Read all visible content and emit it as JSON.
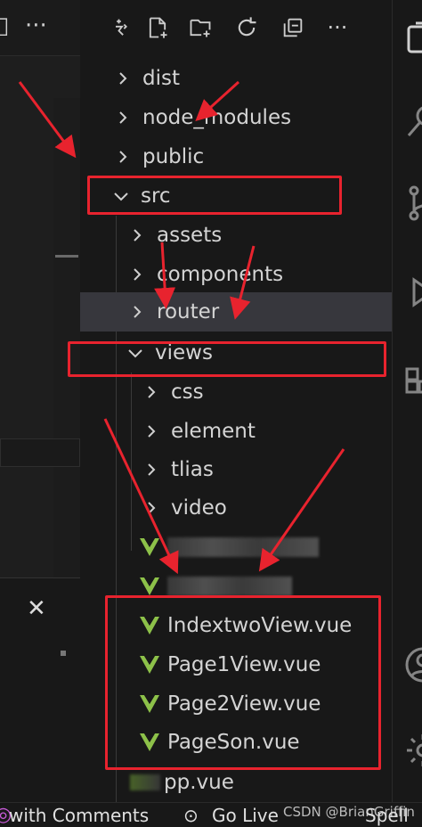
{
  "left_panel": {
    "more_label": "···",
    "close_label": "✕"
  },
  "toolbar": {
    "items": [
      {
        "icon": "extension-icon"
      },
      {
        "icon": "new-file-icon"
      },
      {
        "icon": "new-folder-icon"
      },
      {
        "icon": "refresh-icon"
      },
      {
        "icon": "collapse-all-icon"
      },
      {
        "icon": "more-icon",
        "label": "···"
      }
    ]
  },
  "tree": {
    "dist": "dist",
    "node_modules": "node_modules",
    "public": "public",
    "src": "src",
    "assets": "assets",
    "components": "components",
    "router": "router",
    "views": "views",
    "css": "css",
    "element": "element",
    "tlias": "tlias",
    "video": "video",
    "blurred_1": "...tView.vue",
    "indextwo": "IndextwoView.vue",
    "page1": "Page1View.vue",
    "page2": "Page2View.vue",
    "pageson": "PageSon.vue",
    "app_partial": "pp.vue"
  },
  "status": {
    "comments": "with Comments",
    "golive": "Go Live",
    "spell": "Spell"
  },
  "watermark": "CSDN @BrianGriffin",
  "colors": {
    "annotation_red": "#e8232e",
    "vue_green": "#8dc149",
    "selected_row": "#37373d"
  }
}
